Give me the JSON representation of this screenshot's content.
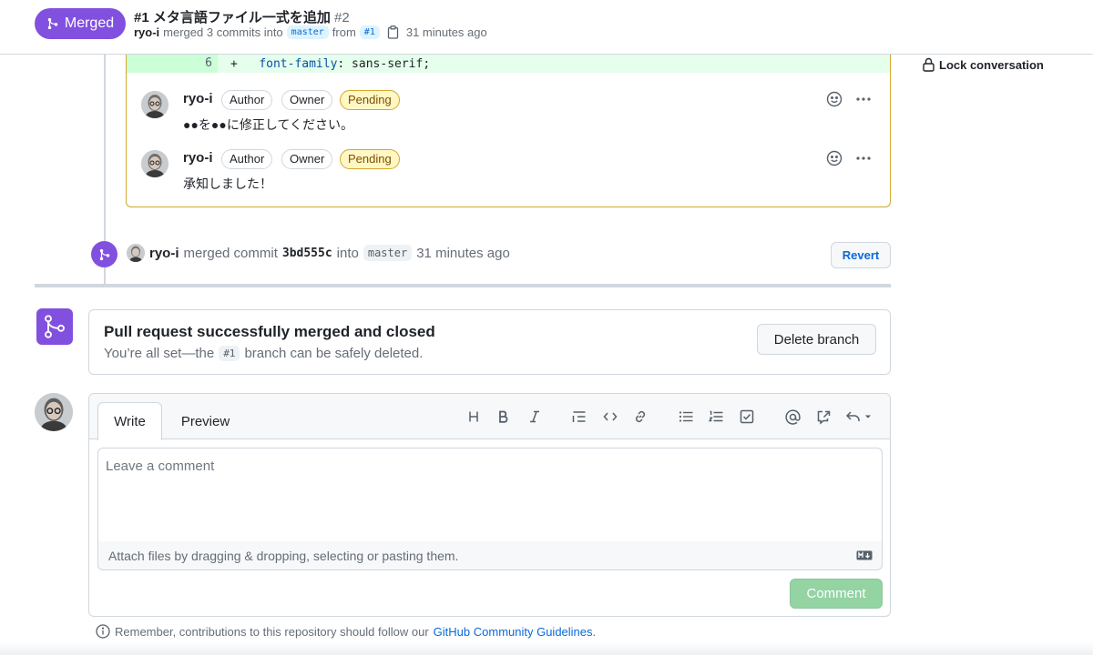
{
  "header": {
    "state_label": "Merged",
    "pr_ref": "#1",
    "title": "メタ言語ファイル一式を追加",
    "number": "#2",
    "meta": {
      "author": "ryo-i",
      "text": "merged 3 commits into",
      "base_branch": "master",
      "from_text": "from",
      "head_branch": "#1",
      "time": "31 minutes ago"
    }
  },
  "sidebar": {
    "lock_label": "Lock conversation"
  },
  "diff": {
    "line_number": "6",
    "marker": "+",
    "property": "font-family",
    "value": ": sans-serif;"
  },
  "review_comments": [
    {
      "author": "ryo-i",
      "badges": [
        "Author",
        "Owner"
      ],
      "status": "Pending",
      "body": "●●を●●に修正してください。"
    },
    {
      "author": "ryo-i",
      "badges": [
        "Author",
        "Owner"
      ],
      "status": "Pending",
      "body": "承知しました！"
    }
  ],
  "merge_event": {
    "author": "ryo-i",
    "text": "merged commit",
    "commit": "3bd555c",
    "into_text": "into",
    "branch": "master",
    "time": "31 minutes ago",
    "revert_label": "Revert"
  },
  "merged_box": {
    "title": "Pull request successfully merged and closed",
    "subtitle_pre": "You’re all set—the",
    "branch": "#1",
    "subtitle_post": "branch can be safely deleted.",
    "delete_label": "Delete branch"
  },
  "comment_form": {
    "tabs": [
      "Write",
      "Preview"
    ],
    "toolbar": [
      "heading-icon",
      "bold-icon",
      "italic-icon",
      "quote-icon",
      "code-icon",
      "link-icon",
      "bulleted-list-icon",
      "numbered-list-icon",
      "task-list-icon",
      "mention-icon",
      "cross-reference-icon",
      "saved-replies-icon"
    ],
    "placeholder": "Leave a comment",
    "attach_hint": "Attach files by dragging & dropping, selecting or pasting them.",
    "submit_label": "Comment"
  },
  "guidelines": {
    "text": "Remember, contributions to this repository should follow our",
    "link": "GitHub Community Guidelines",
    "end": "."
  },
  "colors": {
    "merged": "#8250df",
    "link": "#0969da",
    "pending_bg": "#fff8c5",
    "pending_border": "#d4a72c",
    "diff_add": "#e6ffec",
    "submit_disabled": "#94d3a2"
  }
}
